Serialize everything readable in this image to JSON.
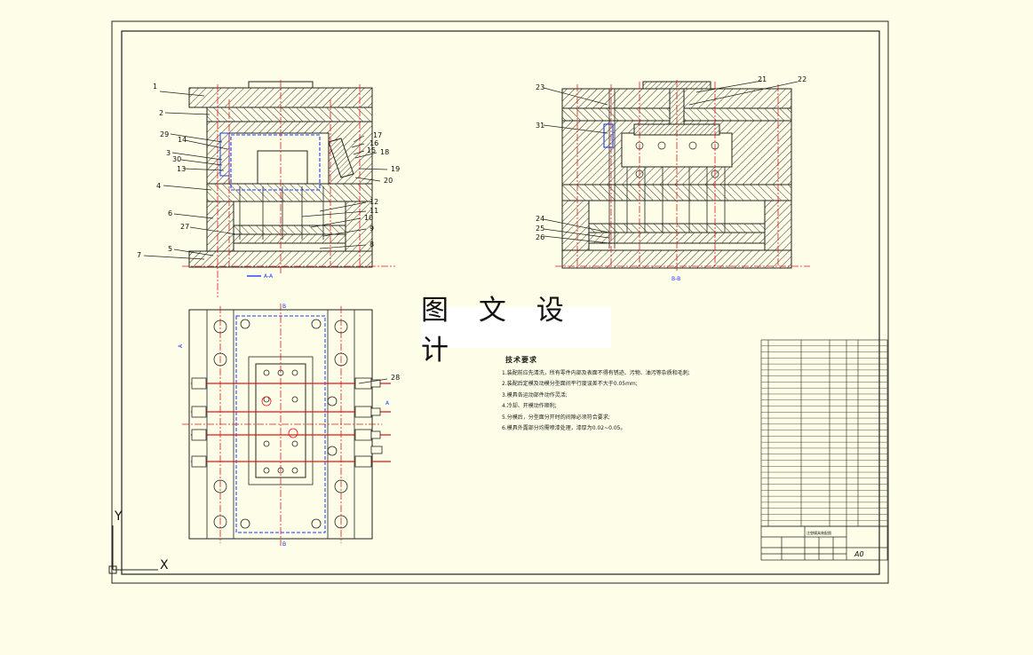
{
  "watermark": "图 文 设 计",
  "technical": {
    "title": "技术要求",
    "lines": [
      "1.装配前应先清洗，所有零件内部及表面不得有锈迹、污物、油污等杂质和毛刺;",
      "2.装配后定模及动模分型面间平行度误差不大于0.05mm;",
      "3.模具各运动部件动作灵活;",
      "4.冷却、开模动作顺利;",
      "5.分模后，分型面分开时的间隙必须符合要求;",
      "6.模具外露部分均需喷漆处理，漆厚为0.02~0.05。"
    ]
  },
  "sections": {
    "aa": "A-A",
    "bb": "B-B",
    "b_mark": "B",
    "a_mark": "A"
  },
  "axes": {
    "x": "X",
    "y": "Y"
  },
  "labels_left": [
    "1",
    "2",
    "29",
    "14",
    "3",
    "30",
    "13",
    "4",
    "6",
    "27",
    "5",
    "7"
  ],
  "labels_mid": [
    "17",
    "16",
    "15",
    "18",
    "19",
    "20",
    "12",
    "11",
    "10",
    "9",
    "8"
  ],
  "labels_right_top": [
    "23",
    "31",
    "21",
    "22"
  ],
  "labels_right_bottom": [
    "24",
    "25",
    "26"
  ],
  "label_plan": "28",
  "bom_rows": 31,
  "title_block": {
    "size": "A0",
    "drawing_name": "注塑模具装配图"
  },
  "colors": {
    "outline": "#1a1a1a",
    "centerline": "#e01818",
    "hidden": "#1a3cff",
    "paper": "#fdfde8"
  }
}
